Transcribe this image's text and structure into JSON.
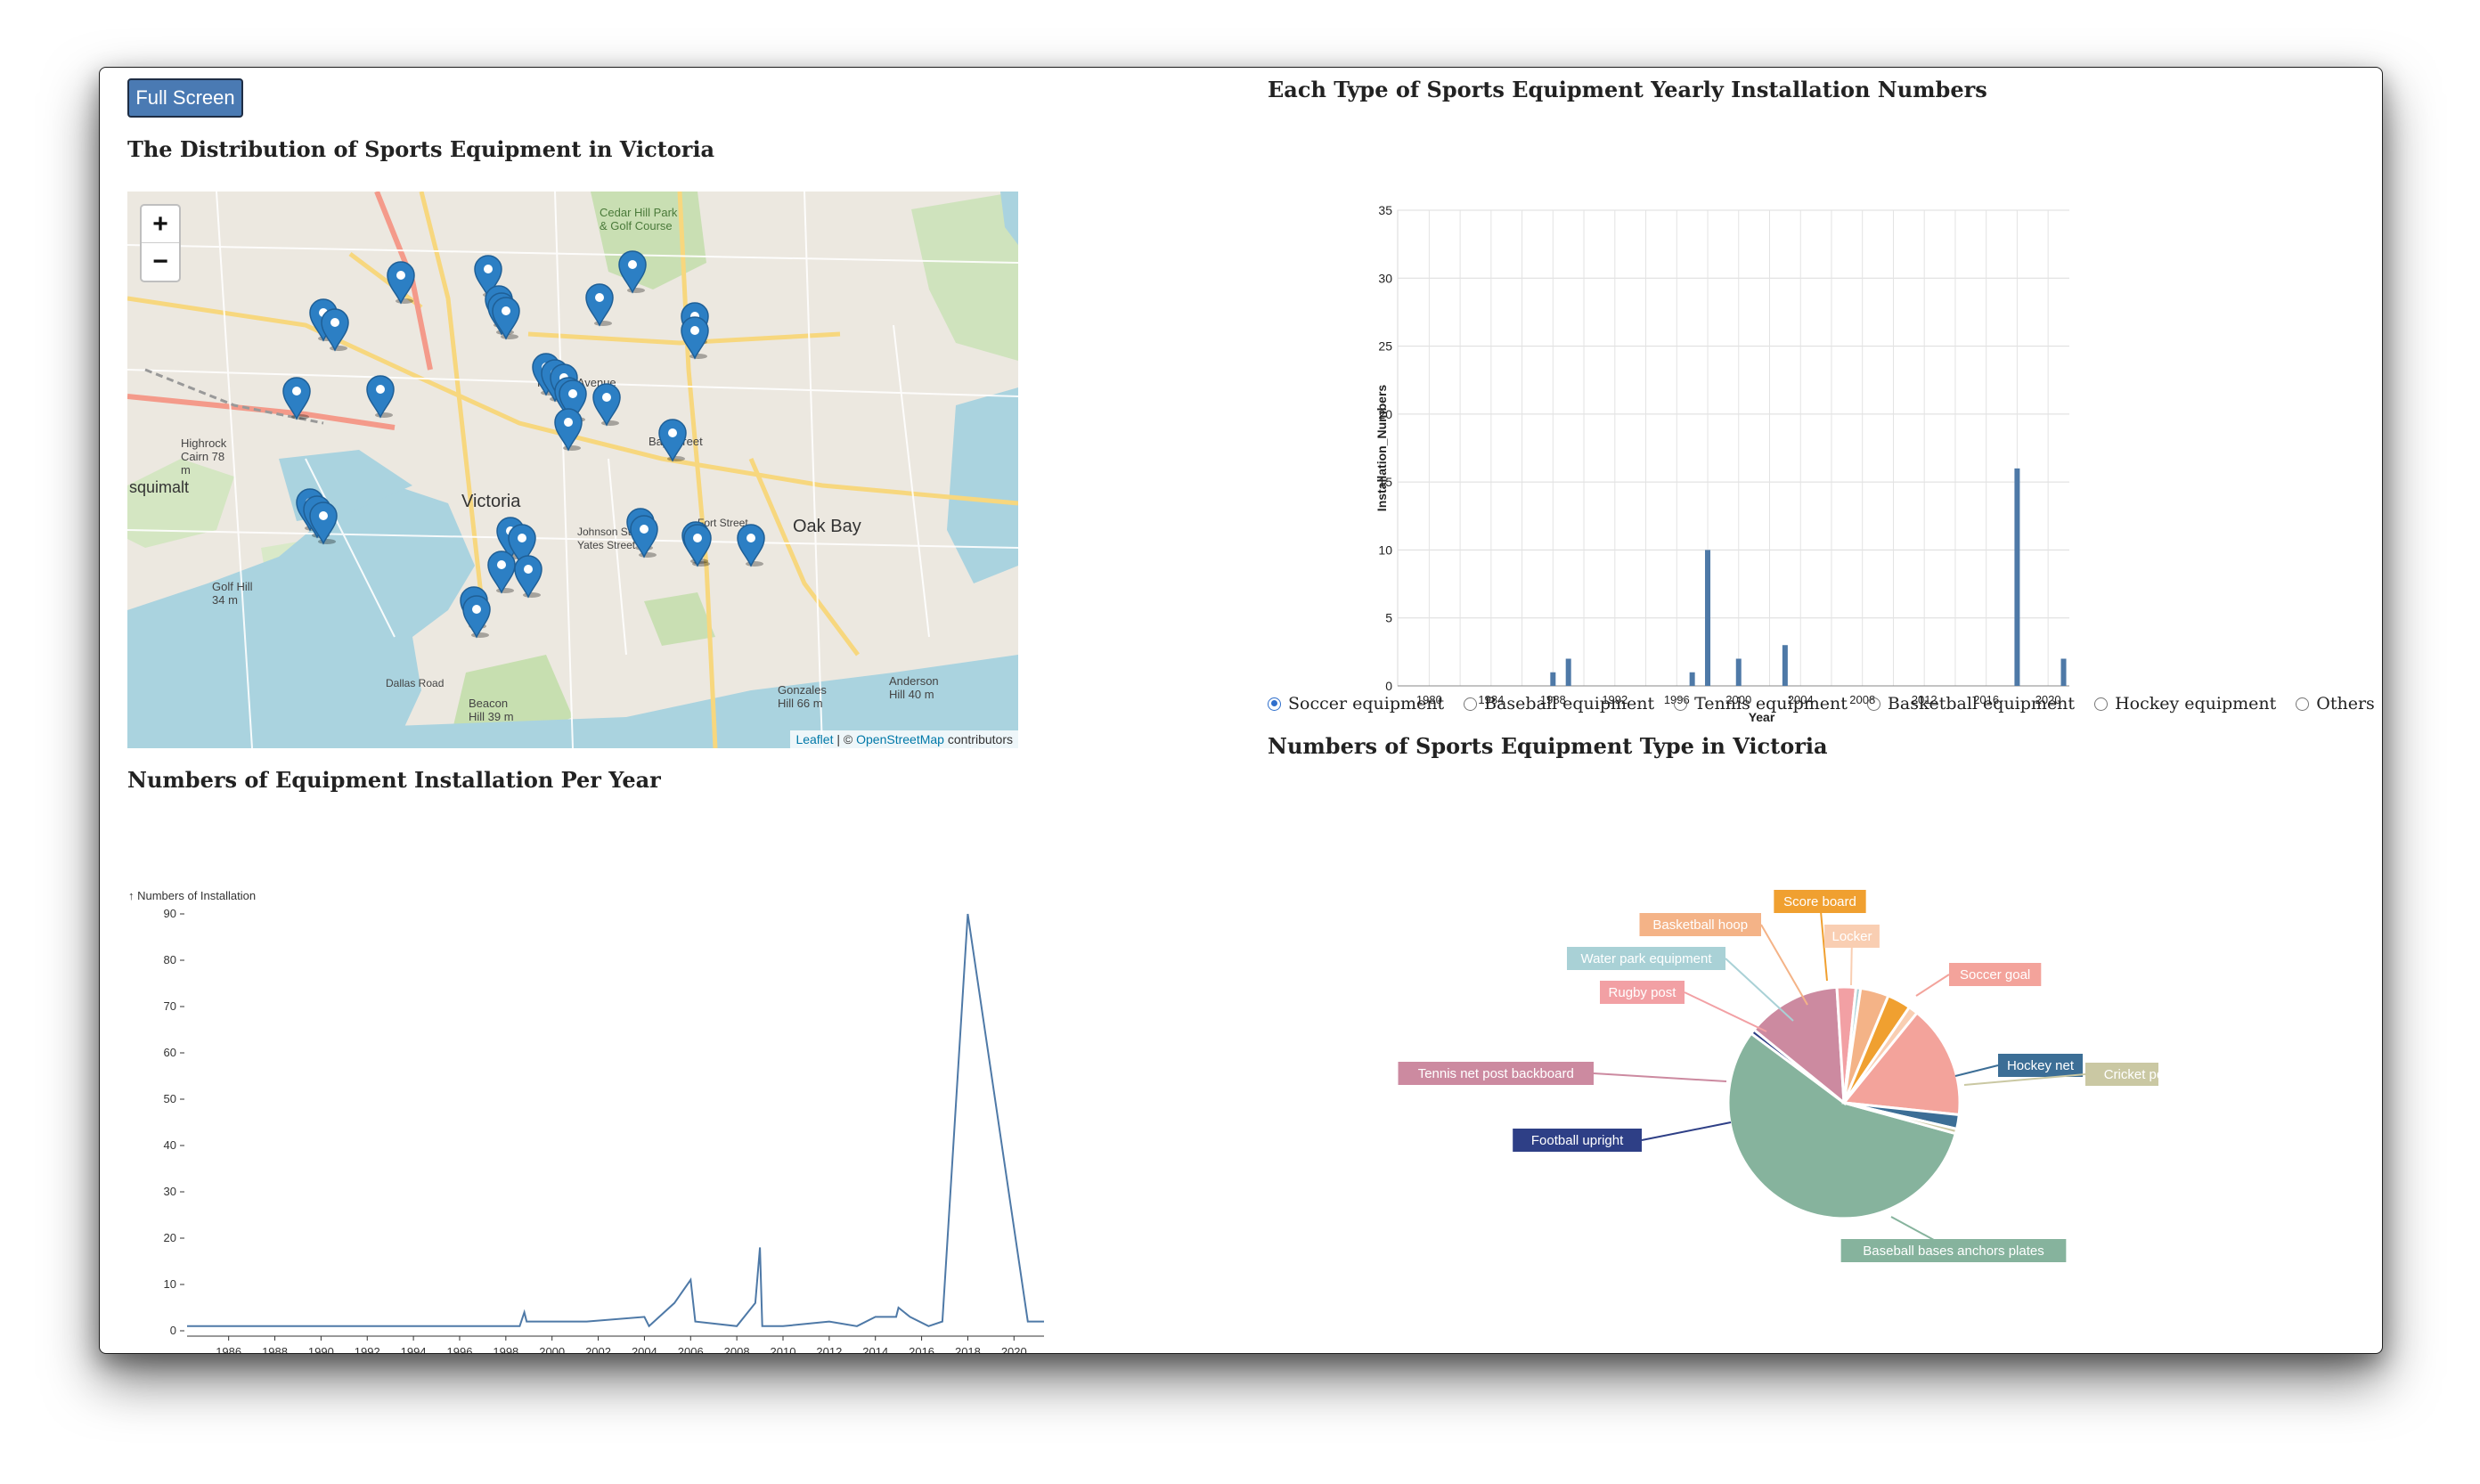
{
  "app": {
    "fullscreen_label": "Full Screen",
    "map_title": "The Distribution of Sports Equipment in Victoria",
    "line_title": "Numbers of Equipment Installation Per Year",
    "bar_title": "Each Type of Sports Equipment Yearly Installation Numbers",
    "pie_title": "Numbers of Sports Equipment Type in Victoria"
  },
  "map": {
    "zoom_in": "+",
    "zoom_out": "−",
    "attribution": {
      "leaflet": "Leaflet",
      "sep": " | © ",
      "osm": "OpenStreetMap",
      "tail": " contributors"
    },
    "labels": {
      "victoria": "Victoria",
      "oak_bay": "Oak Bay",
      "esquimalt": "squimalt",
      "highrock": "Highrock Cairn 78 m",
      "golf_hill": "Golf Hill 34 m",
      "beacon_hill": "Beacon Hill 39 m",
      "gonzales": "Gonzales Hill 66 m",
      "anderson": "Anderson Hill 40 m",
      "cedar_hill": "Cedar Hill Park & Golf Course",
      "bay_street": "Bay Street",
      "hillside": "Hillside Avenue",
      "johnson": "Johnson Street",
      "yates": "Yates Street",
      "fort": "Fort Street",
      "dallas": "Dallas Road"
    }
  },
  "radio": {
    "selected": "Soccer equipment",
    "options": [
      "Soccer equipment",
      "Baseball equipment",
      "Tennis equipment",
      "Basketball equipment",
      "Hockey equipment",
      "Others"
    ]
  },
  "chart_data": [
    {
      "type": "line",
      "title": "Numbers of Equipment Installation Per Year",
      "ylabel": "↑ Numbers of Installation",
      "xlim": [
        1984.2,
        2021.3
      ],
      "ylim": [
        0,
        90
      ],
      "yticks": [
        0,
        10,
        20,
        30,
        40,
        50,
        60,
        70,
        80,
        90
      ],
      "xticks": [
        1986,
        1988,
        1990,
        1992,
        1994,
        1996,
        1998,
        2000,
        2002,
        2004,
        2006,
        2008,
        2010,
        2012,
        2014,
        2016,
        2018,
        2020
      ],
      "grid": false,
      "color": "#4e79a7",
      "x": [
        1984.2,
        1998.6,
        1998.8,
        1998.9,
        2001.5,
        2004,
        2004.2,
        2005.3,
        2006,
        2006.2,
        2008,
        2008.8,
        2009,
        2009.1,
        2009.3,
        2010,
        2012,
        2013.2,
        2014,
        2014.1,
        2014.9,
        2015,
        2015.5,
        2016.3,
        2016.9,
        2018,
        2020.6,
        2021.3
      ],
      "y": [
        1,
        1,
        4,
        2,
        2,
        3,
        1,
        6,
        11,
        2,
        1,
        6,
        18,
        1,
        1,
        1,
        2,
        1,
        3,
        3,
        3,
        5,
        3,
        1,
        2,
        90,
        2,
        2
      ]
    },
    {
      "type": "bar",
      "title": "Each Type of Sports Equipment Yearly Installation Numbers",
      "xlabel": "Year",
      "ylabel": "Installation_Numbers",
      "xlim": [
        1979,
        2025
      ],
      "ylim": [
        0,
        35
      ],
      "yticks": [
        0,
        5,
        10,
        15,
        20,
        25,
        30,
        35
      ],
      "xticks": [
        1980,
        1984,
        1988,
        1992,
        1996,
        2000,
        2004,
        2008,
        2012,
        2016,
        2020,
        2024
      ],
      "grid": true,
      "color": "#4e79a7",
      "categories": [
        1988,
        1989,
        1997,
        1998,
        2000,
        2003,
        2018,
        2021
      ],
      "values": [
        1,
        2,
        1,
        10,
        2,
        3,
        16,
        2
      ]
    },
    {
      "type": "pie",
      "title": "Numbers of Sports Equipment Type in Victoria",
      "slices": [
        {
          "label": "Baseball bases anchors plates",
          "value": 85,
          "color": "#86b39d"
        },
        {
          "label": "Football upright",
          "value": 1,
          "color": "#2e3f86"
        },
        {
          "label": "Tennis net post backboard",
          "value": 20,
          "color": "#cc8aa0"
        },
        {
          "label": "Rugby post",
          "value": 4,
          "color": "#f2a0a4"
        },
        {
          "label": "Water park equipment",
          "value": 1,
          "color": "#a9d1d6"
        },
        {
          "label": "Basketball hoop",
          "value": 6,
          "color": "#f4b387"
        },
        {
          "label": "Score board",
          "value": 5,
          "color": "#f0a030"
        },
        {
          "label": "Locker",
          "value": 2,
          "color": "#f9ceb2"
        },
        {
          "label": "Soccer goal",
          "value": 24,
          "color": "#f3a39b"
        },
        {
          "label": "Hockey net",
          "value": 3,
          "color": "#3c6e96"
        },
        {
          "label": "Cricket poles net",
          "value": 1,
          "color": "#cac8a3"
        }
      ]
    }
  ]
}
